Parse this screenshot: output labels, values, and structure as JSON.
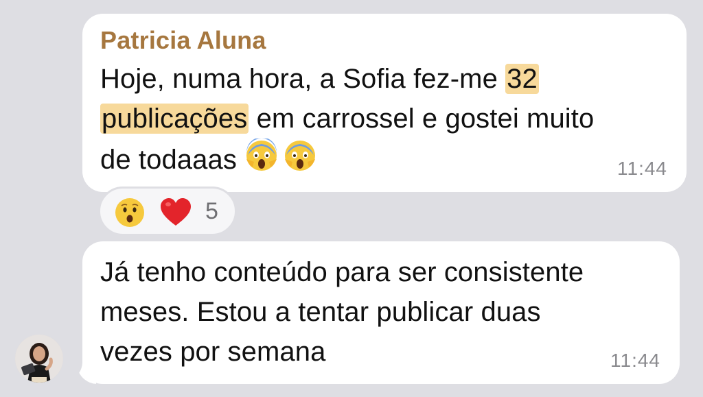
{
  "messages": [
    {
      "sender": "Patricia Aluna",
      "text_line1_a": "Hoje, numa hora, a Sofia fez-me ",
      "text_line1_hl": "32",
      "text_line2_hl": "publicações",
      "text_line2_b": " em carrossel e gostei muito",
      "text_line3": "de todaaas ",
      "emojis": [
        "scream-emoji",
        "scream-emoji"
      ],
      "time": "11:44",
      "reactions": {
        "emojis": [
          "hushed-face-emoji",
          "red-heart-emoji"
        ],
        "count": "5"
      }
    },
    {
      "text_line1": "Já tenho conteúdo para ser consistente",
      "text_line2": "meses. Estou a tentar publicar duas",
      "text_line3": "vezes por semana",
      "time": "11:44"
    }
  ],
  "colors": {
    "background": "#dedee3",
    "bubble": "#ffffff",
    "sender_name": "#a6773f",
    "highlight": "#f7d99b",
    "timestamp": "#8a8a8e"
  }
}
